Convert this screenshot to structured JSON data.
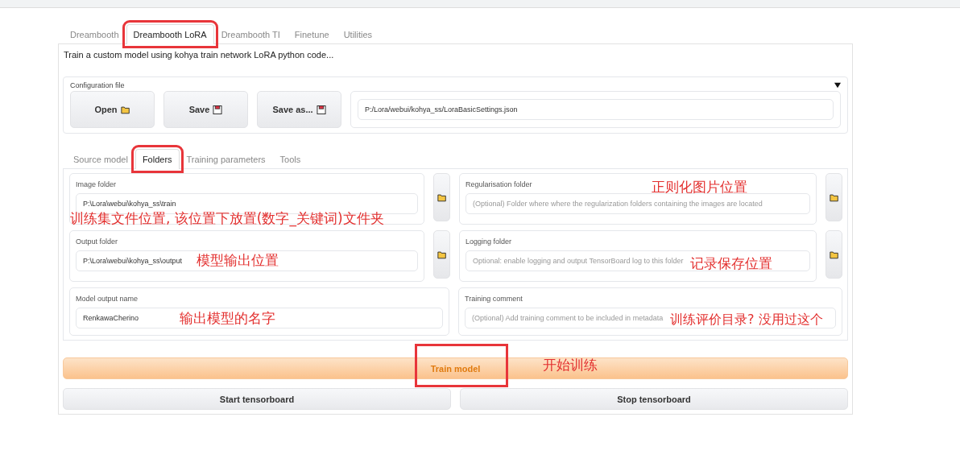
{
  "tabs": [
    {
      "label": "Dreambooth",
      "selected": false,
      "highlighted": false
    },
    {
      "label": "Dreambooth LoRA",
      "selected": true,
      "highlighted": true
    },
    {
      "label": "Dreambooth TI",
      "selected": false,
      "highlighted": false
    },
    {
      "label": "Finetune",
      "selected": false,
      "highlighted": false
    },
    {
      "label": "Utilities",
      "selected": false,
      "highlighted": false
    }
  ],
  "description": "Train a custom model using kohya train network LoRA python code...",
  "config": {
    "title": "Configuration file",
    "expanded": true,
    "path": "P:/Lora/webui/kohya_ss/LoraBasicSettings.json",
    "buttons": [
      {
        "label": "Open",
        "kind": "open"
      },
      {
        "label": "Save",
        "kind": "save"
      },
      {
        "label": "Save as...",
        "kind": "save"
      }
    ]
  },
  "subtabs": [
    {
      "label": "Source model",
      "selected": false,
      "highlighted": false
    },
    {
      "label": "Folders",
      "selected": true,
      "highlighted": true
    },
    {
      "label": "Training parameters",
      "selected": false,
      "highlighted": false
    },
    {
      "label": "Tools",
      "selected": false,
      "highlighted": false
    }
  ],
  "folder_fields": [
    {
      "label": "Image folder",
      "value": "P:\\Lora\\webui\\kohya_ss\\train",
      "annotation": "训练集文件位置, 该位置下放置(数字_关键词)文件夹"
    },
    {
      "label": "Regularisation folder",
      "placeholder": "(Optional) Folder where where the regularization folders containing the images are located",
      "annotation": "正则化图片位置"
    },
    {
      "label": "Output folder",
      "value": "P:\\Lora\\webui\\kohya_ss\\output",
      "annotation": "模型输出位置"
    },
    {
      "label": "Logging folder",
      "placeholder": "Optional: enable logging and output TensorBoard log to this folder",
      "annotation": "记录保存位置"
    }
  ],
  "text_fields": [
    {
      "label": "Model output name",
      "value": "RenkawaCherino",
      "annotation": "输出模型的名字"
    },
    {
      "label": "Training comment",
      "placeholder": "(Optional) Add training comment to be included in metadata",
      "annotation": "训练评价目录? 没用过这个"
    }
  ],
  "train_button": {
    "label": "Train model",
    "highlighted": true,
    "annotation": "开始训练"
  },
  "tensorboard_buttons": [
    "Start tensorboard",
    "Stop tensorboard"
  ]
}
